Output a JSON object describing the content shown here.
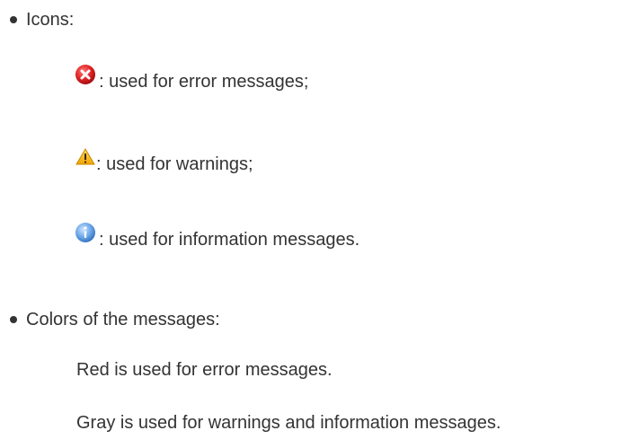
{
  "icons_section": {
    "heading": "Icons:",
    "items": [
      {
        "icon": "error-icon",
        "text": ": used for error messages;"
      },
      {
        "icon": "warning-icon",
        "text": ": used for warnings;"
      },
      {
        "icon": "info-icon",
        "text": ": used for information messages."
      }
    ]
  },
  "colors_section": {
    "heading": "Colors of the messages:",
    "lines": [
      "Red is used for error messages.",
      "Gray is used for warnings and information messages."
    ]
  },
  "palette": {
    "text": "#333333",
    "error_red": "#d9232a",
    "warning_yellow": "#f2b01e",
    "info_blue": "#4f8fd6"
  }
}
